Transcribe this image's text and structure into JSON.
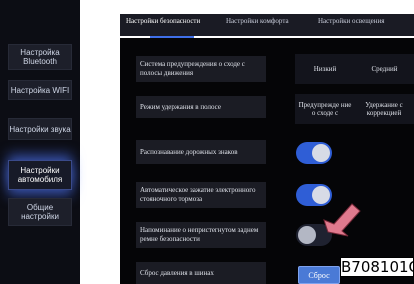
{
  "colors": {
    "accent": "#2f5ed6",
    "active_glow": "#5078ff",
    "arrow": "#e07a8e",
    "background": "#050507"
  },
  "sidebar": {
    "items": [
      {
        "label": "Настройка Bluetooth",
        "active": false
      },
      {
        "label": "Настройка WIFI",
        "active": false
      },
      {
        "label": "Настройки звука",
        "active": false
      },
      {
        "label": "Настройки автомобиля",
        "active": true
      },
      {
        "label": "Общие настройки",
        "active": false
      }
    ]
  },
  "tabs": [
    {
      "label": "Настройки безопасности",
      "active": true
    },
    {
      "label": "Настройки комфорта",
      "active": false
    },
    {
      "label": "Настройки освещения",
      "active": false
    }
  ],
  "settings": {
    "lane_warning": {
      "label": "Система предупреждения о сходе с полосы движения",
      "options": [
        "Низкий",
        "Средний"
      ]
    },
    "lane_keeping": {
      "label": "Режим удержания в полосе",
      "options": [
        "Предупрежде ние о сходе с",
        "Удержание с коррекцией"
      ]
    },
    "traffic_sign_recognition": {
      "label": "Распознавание дорожных знаков",
      "state": "on"
    },
    "auto_parking_brake": {
      "label": "Автоматическое зажатие электронного стояночного тормоза",
      "state": "on"
    },
    "seatbelt_reminder": {
      "label": "Напоминание о непристегнутом заднем ремне безопасности",
      "state": "off"
    },
    "tire_pressure_reset": {
      "label": "Сброс давления в шинах",
      "button_label": "Сброс"
    }
  },
  "annotation": {
    "code": "B708101O",
    "arrow_icon": "pointer-arrow-icon"
  }
}
